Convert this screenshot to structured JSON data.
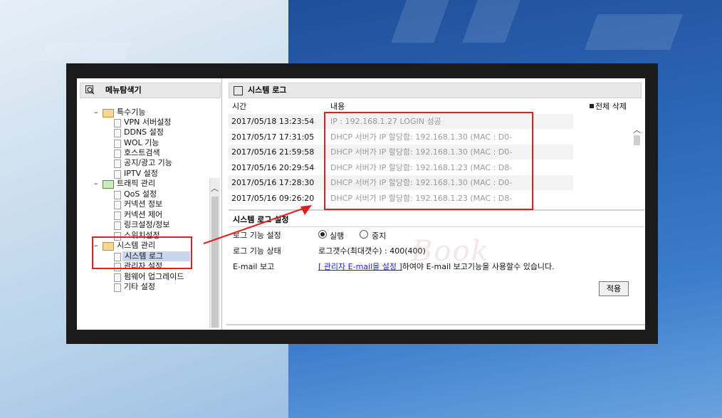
{
  "tree": {
    "title": "메뉴탐색기",
    "groups": [
      {
        "label": "특수기능",
        "items": [
          "VPN 서버설정",
          "DDNS 설정",
          "WOL 기능",
          "호스트검색",
          "공지/광고 기능",
          "IPTV 설정"
        ]
      },
      {
        "label": "트래픽 관리",
        "items": [
          "QoS 설정",
          "커넥션 정보",
          "커넥션 제어",
          "링크설정/정보",
          "스위치설정"
        ]
      },
      {
        "label": "시스템 관리",
        "items": [
          "시스템 로그",
          "관리자 설정",
          "펌웨어 업그레이드",
          "기타 설정"
        ]
      }
    ],
    "selected": "시스템 로그"
  },
  "panel": {
    "title": "시스템 로그",
    "columns": {
      "time": "시간",
      "content": "내용"
    },
    "delete_all": "전체 삭제",
    "logs": [
      {
        "time": "2017/05/18 13:23:54",
        "content": "IP : 192.168.1.27 LOGIN 성공"
      },
      {
        "time": "2017/05/17 17:31:05",
        "content": "DHCP 서버가 IP 할당함: 192.168.1.30 (MAC : D0-"
      },
      {
        "time": "2017/05/16 21:59:58",
        "content": "DHCP 서버가 IP 할당함: 192.168.1.30 (MAC : D0-"
      },
      {
        "time": "2017/05/16 20:29:54",
        "content": "DHCP 서버가 IP 할당함: 192.168.1.23 (MAC : D8-"
      },
      {
        "time": "2017/05/16 17:28:30",
        "content": "DHCP 서버가 IP 할당함: 192.168.1.30 (MAC : D0-"
      },
      {
        "time": "2017/05/16 09:26:20",
        "content": "DHCP 서버가 IP 할당함: 192.168.1.23 (MAC : D8-"
      }
    ]
  },
  "settings": {
    "title": "시스템 로그 설정",
    "log_function_label": "로그 기능 설정",
    "run_label": "실행",
    "stop_label": "중지",
    "selected_option": "실행",
    "log_status_label": "로그 기능 상태",
    "log_status_value": "로그갯수(최대갯수) : 400(400)",
    "email_label": "E-mail 보고",
    "email_link": "[ 관리자 E-mail을 설정 ]",
    "email_text": "하여야 E-mail 보고기능을 사용할수 있습니다.",
    "apply_label": "적용"
  },
  "watermark": "Book",
  "colors": {
    "highlight": "#e02020",
    "link": "#2222cc"
  }
}
